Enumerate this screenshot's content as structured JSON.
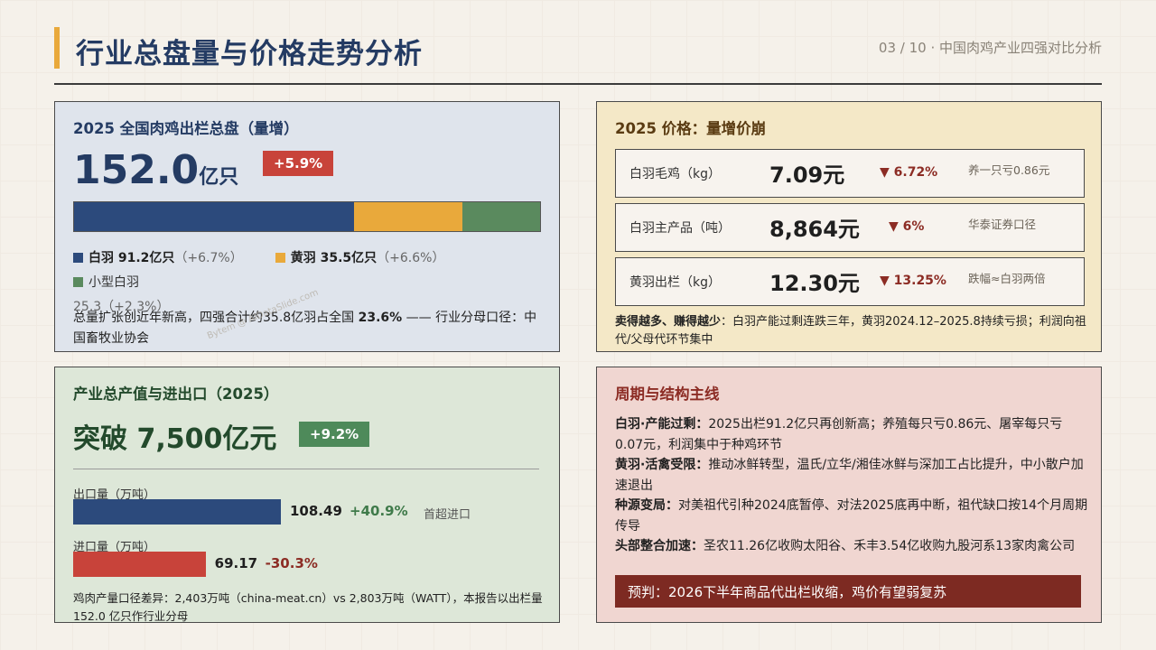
{
  "header": {
    "title": "行业总盘量与价格走势分析",
    "breadcrumb": "03 / 10 · 中国肉鸡产业四强对比分析"
  },
  "colors": {
    "navy": "#2c4a7c",
    "amber": "#e9a93b",
    "green": "#5a8a5e",
    "red": "#c8433a",
    "dark_red": "#7d2a22"
  },
  "volume": {
    "title": "2025 全国肉鸡出栏总盘（量增）",
    "total_value": "152.0",
    "total_unit": "亿只",
    "growth_badge": "+5.9%",
    "segments": [
      {
        "name": "白羽 91.2亿只",
        "growth": "（+6.7%）",
        "value": 91.2,
        "color": "#2c4a7c"
      },
      {
        "name": "黄羽 35.5亿只",
        "growth": "（+6.6%）",
        "value": 35.5,
        "color": "#e9a93b"
      },
      {
        "name": "小型白羽",
        "growth": "25.3（+2.3%）",
        "value": 25.3,
        "color": "#5a8a5e"
      }
    ],
    "note_text": "总量扩张创近年新高，四强合计约35.8亿羽占全国 ",
    "note_bold": "23.6%",
    "note_tail": " —— 行业分母口径：中国畜牧业协会"
  },
  "price": {
    "title": "2025 价格：量增价崩",
    "rows": [
      {
        "label": "白羽毛鸡（kg）",
        "value": "7.09元",
        "change": "▼ 6.72%",
        "remark": "养一只亏0.86元"
      },
      {
        "label": "白羽主产品（吨）",
        "value": "8,864元",
        "change": "▼ 6%",
        "remark": "华泰证券口径"
      },
      {
        "label": "黄羽出栏（kg）",
        "value": "12.30元",
        "change": "▼ 13.25%",
        "remark": "跌幅≈白羽两倍"
      }
    ],
    "note_bold": "卖得越多、赚得越少",
    "note_text": "：白羽产能过剩连跌三年，黄羽2024.12–2025.8持续亏损；利润向祖代/父母代环节集中"
  },
  "output": {
    "title": "产业总产值与进出口（2025）",
    "big_value": "突破 7,500亿元",
    "growth_badge": "+9.2%",
    "export": {
      "label": "出口量（万吨）",
      "value": 108.49,
      "value_text": "108.49",
      "change": "+40.9%",
      "remark": "首超进口"
    },
    "import": {
      "label": "进口量（万吨）",
      "value": 69.17,
      "value_text": "69.17",
      "change": "-30.3%"
    },
    "note": "鸡肉产量口径差异：2,403万吨（china-meat.cn）vs 2,803万吨（WATT），本报告以出栏量 152.0 亿只作行业分母"
  },
  "cycle": {
    "title": "周期与结构主线",
    "items": [
      {
        "head": "白羽·产能过剩：",
        "text": "2025出栏91.2亿只再创新高；养殖每只亏0.86元、屠宰每只亏0.07元，利润集中于种鸡环节"
      },
      {
        "head": "黄羽·活禽受限：",
        "text": "推动冰鲜转型，温氏/立华/湘佳冰鲜与深加工占比提升，中小散户加速退出"
      },
      {
        "head": "种源变局：",
        "text": "对美祖代引种2024底暂停、对法2025底再中断，祖代缺口按14个月周期传导"
      },
      {
        "head": "头部整合加速：",
        "text": "圣农11.26亿收购太阳谷、禾丰3.54亿收购九股河系13家肉禽公司"
      }
    ],
    "forecast": "预判：2026下半年商品代出栏收缩，鸡价有望弱复苏"
  },
  "watermark": "Bytem @ AIDataSlide.com"
}
